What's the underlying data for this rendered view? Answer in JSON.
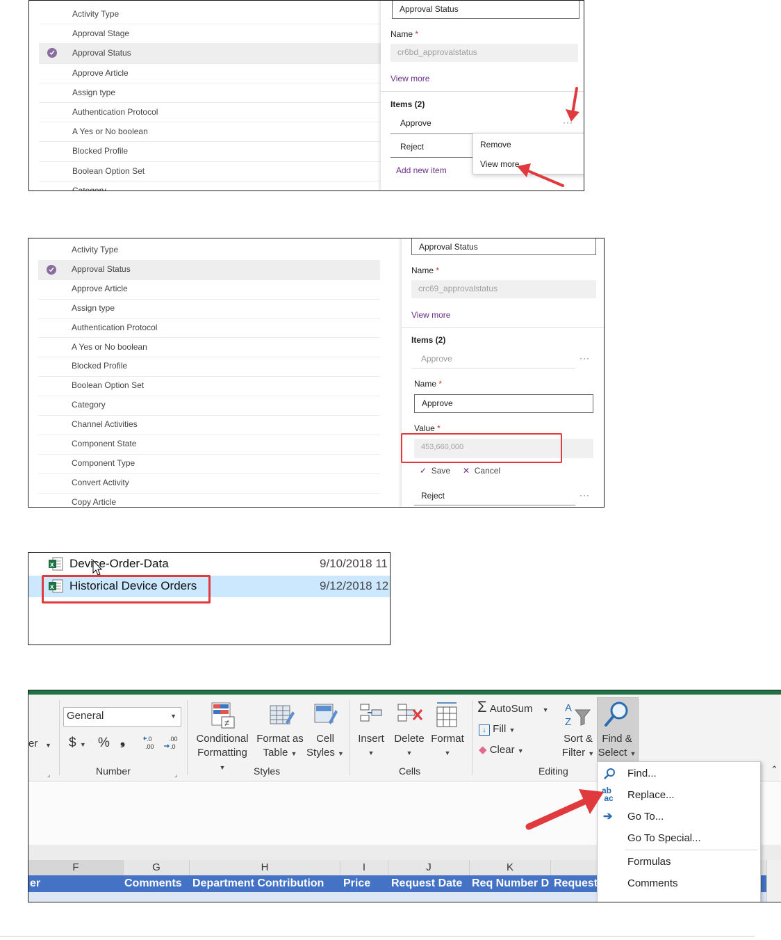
{
  "panel1": {
    "list_items": [
      "Activity Type",
      "Approval Stage",
      "Approval Status",
      "Approve Article",
      "Assign type",
      "Authentication Protocol",
      "A Yes or No boolean",
      "Blocked Profile",
      "Boolean Option Set",
      "Category"
    ],
    "selected_index": 2,
    "display_name_value": "Approval Status",
    "name_label": "Name",
    "name_value": "cr6bd_approvalstatus",
    "view_more": "View more",
    "items_header": "Items (2)",
    "item1": "Approve",
    "item2": "Reject",
    "add_new_item": "Add new item",
    "ellipsis": "···",
    "menu_remove": "Remove",
    "menu_view_more": "View more"
  },
  "panel2": {
    "list_items": [
      "Activity Type",
      "Approval Status",
      "Approve Article",
      "Assign type",
      "Authentication Protocol",
      "A Yes or No boolean",
      "Blocked Profile",
      "Boolean Option Set",
      "Category",
      "Channel Activities",
      "Component State",
      "Component Type",
      "Convert Activity",
      "Copy Article"
    ],
    "selected_index": 1,
    "display_name_value": "Approval Status",
    "name_label": "Name",
    "name_value": "crc69_approvalstatus",
    "view_more": "View more",
    "items_header": "Items (2)",
    "item1": "Approve",
    "option_name_label": "Name",
    "option_name_value": "Approve",
    "value_label": "Value",
    "value_value": "453,660,000",
    "save": "Save",
    "cancel": "Cancel",
    "item2": "Reject",
    "ellipsis": "···"
  },
  "panel3": {
    "files": [
      {
        "name": "Device-Order-Data",
        "date": "9/10/2018 11"
      },
      {
        "name": "Historical Device Orders",
        "date": "9/12/2018 12"
      }
    ]
  },
  "panel4": {
    "partial_label": "er",
    "number_format": "General",
    "currency_symbol": "$",
    "percent_symbol": "%",
    "comma_symbol": "❟",
    "number_group": "Number",
    "conditional_formatting": [
      "Conditional",
      "Formatting"
    ],
    "format_as_table": [
      "Format as",
      "Table"
    ],
    "cell_styles": [
      "Cell",
      "Styles"
    ],
    "styles_group": "Styles",
    "insert": "Insert",
    "delete": "Delete",
    "format": "Format",
    "cells_group": "Cells",
    "autosum": "AutoSum",
    "fill": "Fill",
    "clear": "Clear",
    "sort_filter": [
      "Sort &",
      "Filter"
    ],
    "find_select": [
      "Find &",
      "Select"
    ],
    "editing_group": "Editing",
    "menu": [
      "Find...",
      "Replace...",
      "Go To...",
      "Go To Special...",
      "Formulas",
      "Comments"
    ],
    "columns": [
      "F",
      "G",
      "H",
      "I",
      "J",
      "K"
    ],
    "headers": [
      "er",
      "Comments",
      "Department Contribution",
      "Price",
      "Request Date",
      "Req Number D",
      "Request"
    ],
    "colors": {
      "excel_green": "#217346",
      "header_blue": "#4472c4",
      "highlight": "#d0d0d0"
    }
  }
}
